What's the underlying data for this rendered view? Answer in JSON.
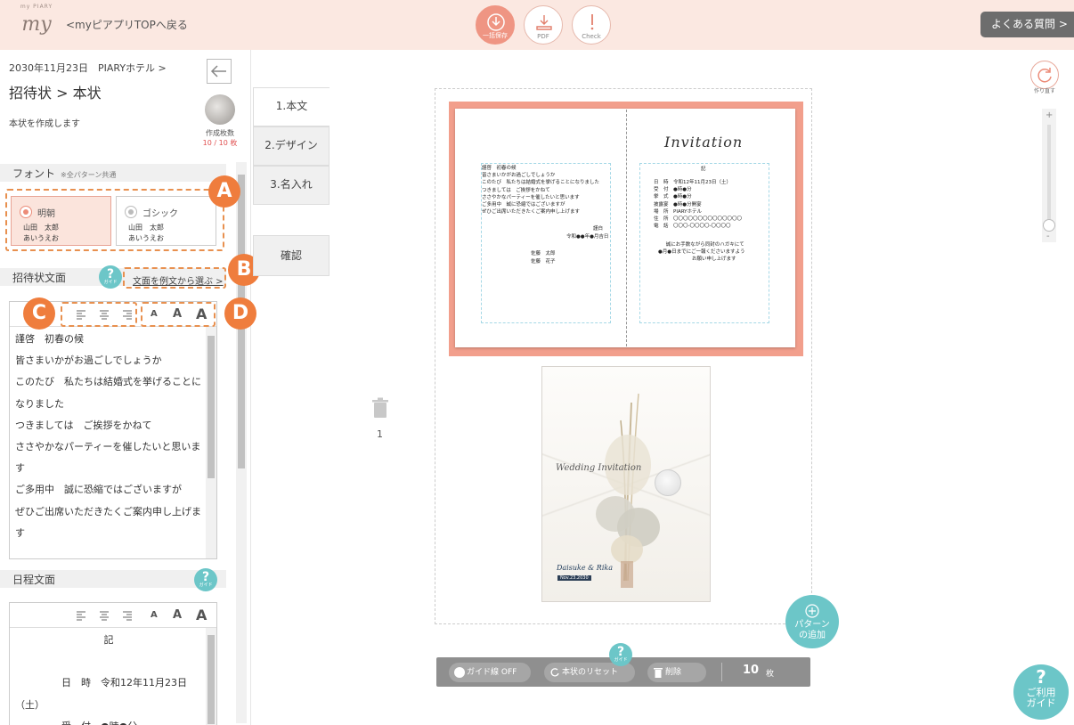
{
  "header": {
    "logo_top": "my PIARY",
    "logo_main": "my",
    "back_link": "<myピアプリTOPへ戻る",
    "download_label": "一括保存",
    "pdf_label": "PDF",
    "check_label": "Check",
    "faq_label": "よくある質問 >"
  },
  "left": {
    "breadcrumb": "2030年11月23日　PIARYホテル >",
    "title": "招待状 > 本状",
    "subtitle": "本状を作成します",
    "count_label": "作成枚数",
    "count_value": "10 / 10 枚",
    "font_section": "フォント",
    "font_note": "※全パターン共通",
    "font_options": [
      {
        "name": "明朝",
        "sample1": "山田　太郎",
        "sample2": "あいうえお",
        "selected": true
      },
      {
        "name": "ゴシック",
        "sample1": "山田　太郎",
        "sample2": "あいうえお",
        "selected": false
      }
    ],
    "letter_section": "招待状文面",
    "guide_label": "ガイド",
    "example_link": "文面を例文から選ぶ >",
    "size_small": "A",
    "size_medium": "A",
    "size_large": "A",
    "letter_lines": [
      "謹啓　初春の候",
      "皆さまいかがお過ごしでしょうか",
      "このたび　私たちは結婚式を挙げることに",
      "なりました",
      "つきましては　ご挨拶をかねて",
      "ささやかなパーティーを催したいと思いま",
      "す",
      "ご多用中　誠に恐縮ではございますが",
      "ぜひご出席いただきたくご案内申し上げま",
      "す"
    ],
    "schedule_section": "日程文面",
    "schedule_lines": [
      "記",
      "",
      "日　時　令和12年11月23日",
      "（土）",
      "受　付　●時●分"
    ]
  },
  "markers": {
    "a": "A",
    "b": "B",
    "c": "C",
    "d": "D"
  },
  "steps": [
    "1.本文",
    "2.デザイン",
    "3.名入れ"
  ],
  "confirm_label": "確認",
  "preview": {
    "left_text": [
      "謹啓　初春の候",
      "皆さまいかがお過ごしでしょうか",
      "このたび　私たちは結婚式を挙げることになりました",
      "つきましては　ご挨拶をかねて",
      "ささやかなパーティーを催したいと思います",
      "ご多用中　誠に恐縮ではございますが",
      "ぜひご出席いただきたくご案内申し上げます"
    ],
    "left_closing": "謹白",
    "left_date": "令和●●年●月吉日",
    "names": [
      [
        "佐藤　太郎",
        "佐藤　花子"
      ]
    ],
    "inv_title": "Invitation",
    "right_header": "記",
    "right_lines": [
      "日　時　令和12年11月23日（土）",
      "受　付　●時●分",
      "挙　式　●時●分",
      "披露宴　●時●分開宴",
      "場　所　PIARYホテル",
      "住　所　〇〇〇〇〇〇〇〇〇〇〇〇〇〇",
      "電　話　〇〇〇-〇〇〇〇-〇〇〇〇"
    ],
    "right_footer": [
      "誠にお手数ながら同封のハガキにて",
      "●月●日までにご一報くださいますよう",
      "お願い申し上げます"
    ],
    "env_script": "Wedding Invitation",
    "env_names": "Daisuke & Rika",
    "env_date": "Nov.23.2030"
  },
  "page_number": "1",
  "redo_label": "作り直す",
  "add_pattern": "パターンの追加",
  "bottom": {
    "guide": "ガイド線 OFF",
    "reset": "本状のリセット",
    "delete": "削除",
    "count": "10",
    "unit": "枚"
  },
  "usage_guide": "ご利用ガイド",
  "colors": {
    "accent": "#ef9583",
    "teal": "#6cc6c8",
    "marker": "#ef7d3d"
  }
}
